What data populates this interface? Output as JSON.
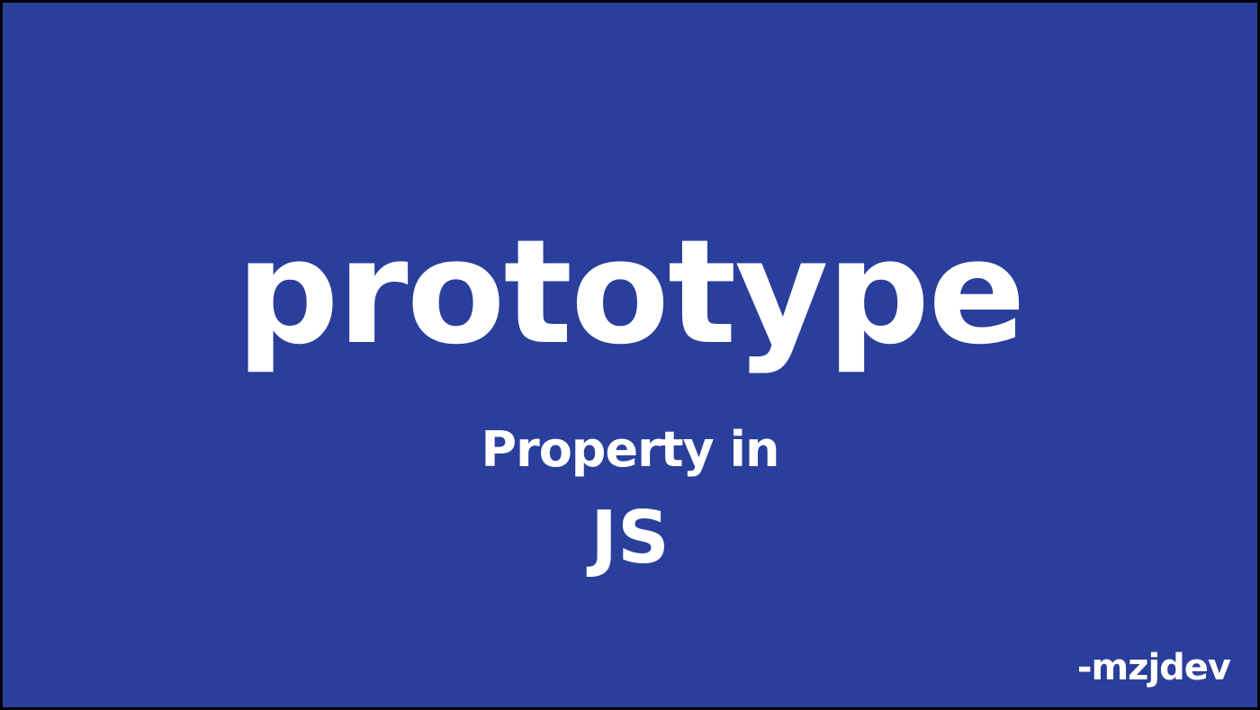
{
  "slide": {
    "title": "prototype",
    "subtitle": "Property in",
    "language": "JS",
    "author": "-mzjdev"
  },
  "colors": {
    "background": "#2a3f9b",
    "border": "#000000",
    "text": "#ffffff"
  }
}
